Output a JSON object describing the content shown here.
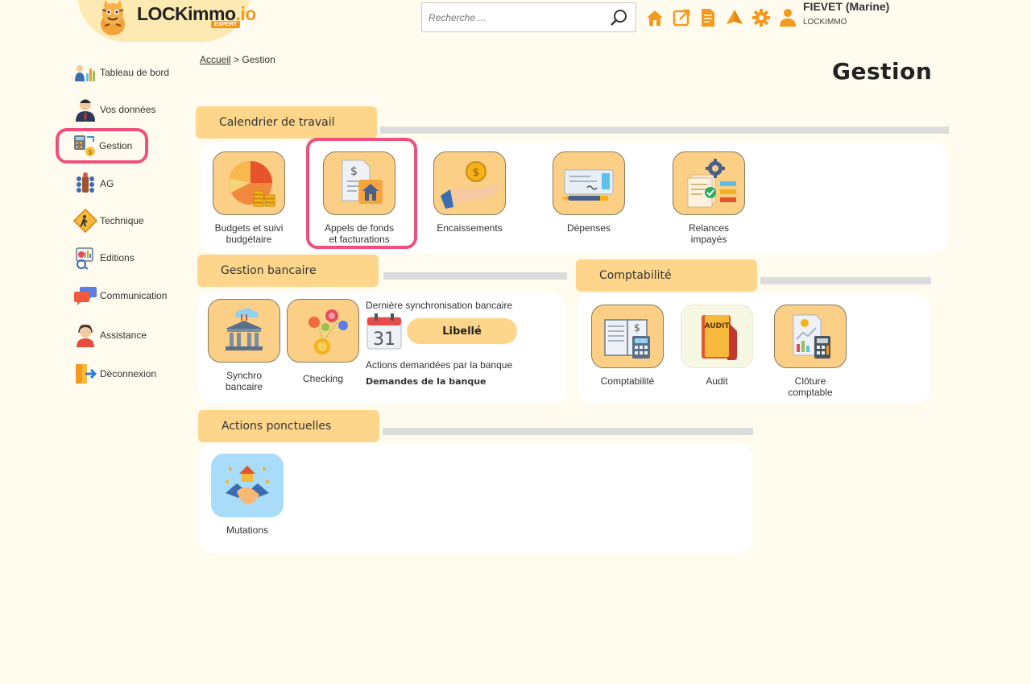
{
  "header": {
    "brand_main": "LOCKimmo",
    "brand_suffix": ".io",
    "brand_badge": "EXPERT",
    "search_placeholder": "Recherche ...",
    "user_name": "FIEVET (Marine)",
    "user_org": "LOCKIMMO",
    "icons": [
      "home-icon",
      "external-link-icon",
      "document-icon",
      "sail-icon",
      "gear-icon",
      "user-icon"
    ]
  },
  "sidebar": {
    "items": [
      {
        "label": "Tableau de bord",
        "icon": "dashboard-icon"
      },
      {
        "label": "Vos données",
        "icon": "person-icon"
      },
      {
        "label": "Gestion",
        "icon": "gestion-icon",
        "active": true
      },
      {
        "label": "AG",
        "icon": "meeting-icon"
      },
      {
        "label": "Technique",
        "icon": "worker-icon"
      },
      {
        "label": "Editions",
        "icon": "report-icon"
      },
      {
        "label": "Communication",
        "icon": "chat-icon"
      },
      {
        "label": "Assistance",
        "icon": "support-icon"
      },
      {
        "label": "Déconnexion",
        "icon": "logout-icon"
      }
    ]
  },
  "breadcrumb": {
    "home": "Accueil",
    "separator": ">",
    "current": "Gestion"
  },
  "page_title": "Gestion",
  "sections": {
    "calendrier": {
      "title": "Calendrier de travail",
      "tiles": [
        {
          "label": "Budgets et suivi budgétaire"
        },
        {
          "label": "Appels de fonds et facturations"
        },
        {
          "label": "Encaissements"
        },
        {
          "label": "Dépenses"
        },
        {
          "label": "Relances impayés"
        }
      ]
    },
    "bancaire": {
      "title": "Gestion bancaire",
      "tiles": [
        {
          "label": "Synchro bancaire"
        },
        {
          "label": "Checking"
        }
      ],
      "sync_label": "Dernière synchronisation bancaire",
      "calendar_day": "31",
      "libelle_button": "Libellé",
      "actions_label": "Actions demandées par la banque",
      "demandes_link": "Demandes de la banque"
    },
    "comptabilite": {
      "title": "Comptabilité",
      "tiles": [
        {
          "label": "Comptabilité"
        },
        {
          "label": "Audit"
        },
        {
          "label": "Clôture comptable"
        }
      ],
      "audit_text": "AUDIT"
    },
    "ponctuelles": {
      "title": "Actions ponctuelles",
      "tiles": [
        {
          "label": "Mutations"
        }
      ]
    }
  },
  "colors": {
    "background": "#fffbef",
    "accent": "#fdd68b",
    "tile": "#fbcf86",
    "highlight": "#f0507e",
    "orange": "#f39a1c"
  }
}
